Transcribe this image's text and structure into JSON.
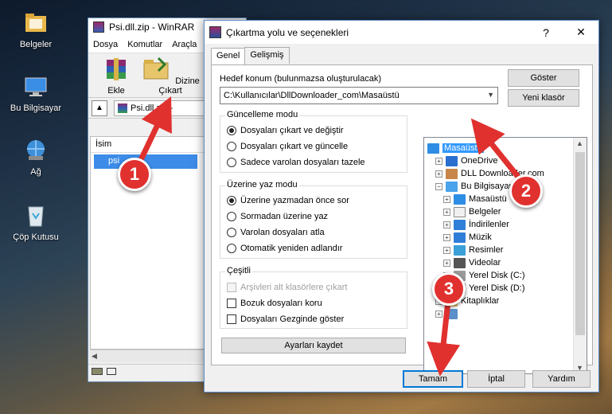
{
  "desktop": {
    "icons": [
      {
        "label": "Belgeler"
      },
      {
        "label": "Bu Bilgisayar"
      },
      {
        "label": "Ağ"
      },
      {
        "label": "Çöp Kutusu"
      }
    ]
  },
  "winrar": {
    "title": "Psi.dll.zip - WinRAR",
    "menu": [
      "Dosya",
      "Komutlar",
      "Araçla"
    ],
    "toolbar": {
      "add_label": "Ekle",
      "extract_label": "Dizine Çıkart"
    },
    "path_value": "Psi.dll.zip -",
    "column_name": "İsim",
    "file_name": "psi"
  },
  "dialog": {
    "title": "Çıkartma yolu ve seçenekleri",
    "help_glyph": "?",
    "close_glyph": "✕",
    "tabs": [
      {
        "label": "Genel",
        "active": true
      },
      {
        "label": "Gelişmiş",
        "active": false
      }
    ],
    "dest_label": "Hedef konum (bulunmazsa oluşturulacak)",
    "dest_value": "C:\\Kullanıcılar\\DllDownloader_com\\Masaüstü",
    "show_button": "Göster",
    "new_folder_button": "Yeni klasör",
    "update_mode": {
      "title": "Güncelleme modu",
      "options": [
        {
          "label": "Dosyaları çıkart ve değiştir",
          "selected": true
        },
        {
          "label": "Dosyaları çıkart ve güncelle",
          "selected": false
        },
        {
          "label": "Sadece varolan dosyaları tazele",
          "selected": false
        }
      ]
    },
    "overwrite_mode": {
      "title": "Üzerine yaz modu",
      "options": [
        {
          "label": "Üzerine yazmadan önce sor",
          "selected": true
        },
        {
          "label": "Sormadan üzerine yaz",
          "selected": false
        },
        {
          "label": "Varolan dosyaları atla",
          "selected": false
        },
        {
          "label": "Otomatik yeniden adlandır",
          "selected": false
        }
      ]
    },
    "misc": {
      "title": "Çeşitli",
      "options": [
        {
          "label": "Arşivleri alt klasörlere çıkart",
          "checked": false,
          "disabled": true
        },
        {
          "label": "Bozuk dosyaları koru",
          "checked": false,
          "disabled": false
        },
        {
          "label": "Dosyaları Gezginde göster",
          "checked": false,
          "disabled": false
        }
      ]
    },
    "save_settings_button": "Ayarları kaydet",
    "tree": [
      {
        "label": "Masaüstü",
        "level": 0,
        "expander": "",
        "selected": true,
        "icon": "desktop-icon"
      },
      {
        "label": "OneDrive",
        "level": 1,
        "expander": "+",
        "selected": false,
        "icon": "onedrive-icon"
      },
      {
        "label": "DLL Downloader.com",
        "level": 1,
        "expander": "+",
        "selected": false,
        "icon": "user-icon"
      },
      {
        "label": "Bu Bilgisayar",
        "level": 1,
        "expander": "−",
        "selected": false,
        "icon": "computer-icon"
      },
      {
        "label": "Masaüstü",
        "level": 2,
        "expander": "+",
        "selected": false,
        "icon": "desktop-icon"
      },
      {
        "label": "Belgeler",
        "level": 2,
        "expander": "+",
        "selected": false,
        "icon": "documents-icon"
      },
      {
        "label": "İndirilenler",
        "level": 2,
        "expander": "+",
        "selected": false,
        "icon": "downloads-icon"
      },
      {
        "label": "Müzik",
        "level": 2,
        "expander": "+",
        "selected": false,
        "icon": "music-icon"
      },
      {
        "label": "Resimler",
        "level": 2,
        "expander": "+",
        "selected": false,
        "icon": "pictures-icon"
      },
      {
        "label": "Videolar",
        "level": 2,
        "expander": "+",
        "selected": false,
        "icon": "videos-icon"
      },
      {
        "label": "Yerel Disk (C:)",
        "level": 2,
        "expander": "+",
        "selected": false,
        "icon": "drive-icon"
      },
      {
        "label": "Yerel Disk (D:)",
        "level": 2,
        "expander": "+",
        "selected": false,
        "icon": "drive-icon"
      },
      {
        "label": "Kitaplıklar",
        "level": 1,
        "expander": "+",
        "selected": false,
        "icon": "libraries-icon"
      },
      {
        "label": "",
        "level": 1,
        "expander": "+",
        "selected": false,
        "icon": "network-icon"
      }
    ],
    "ok_button": "Tamam",
    "cancel_button": "İptal",
    "help_button": "Yardım"
  },
  "annotations": [
    {
      "number": "1"
    },
    {
      "number": "2"
    },
    {
      "number": "3"
    }
  ],
  "colors": {
    "annotation_red": "#e0312f",
    "selection_blue": "#3399ff",
    "accent": "#0078d7"
  }
}
